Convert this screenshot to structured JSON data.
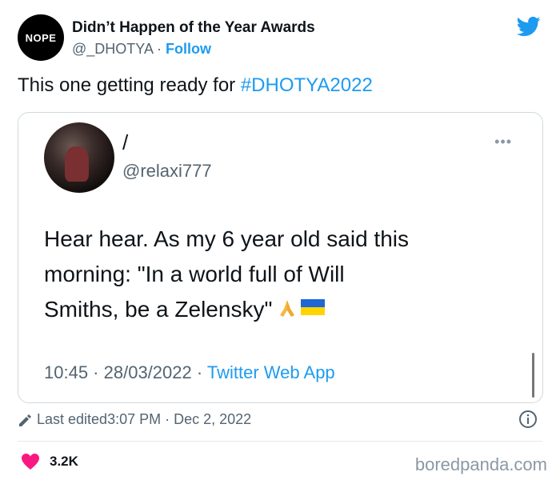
{
  "header": {
    "avatar_text": "NOPE",
    "author_name": "Didn’t Happen of the Year Awards",
    "handle": "@_DHOTYA",
    "separator": " · ",
    "follow_label": "Follow",
    "logo_icon": "twitter-bird-icon",
    "brand_color": "#1d9bf0"
  },
  "tweet": {
    "text": "This one getting ready for ",
    "hashtag": "#DHOTYA2022"
  },
  "quoted": {
    "name": "/",
    "handle": "@relaxi777",
    "more": "•••",
    "line1": "Hear hear. As my 6 year old said this",
    "line2": "morning: \"In a world full of Will",
    "line3": "Smiths, be a Zelensky\"",
    "emoji": "folded-hands-icon",
    "flag": "ukraine-flag-icon",
    "time": "10:45",
    "date": "28/03/2022",
    "dot": " · ",
    "app": "Twitter Web App"
  },
  "footer": {
    "edited_label": "Last edited",
    "edited_time": "3:07 PM",
    "edited_date": "Dec 2, 2022",
    "likes": "3.2K",
    "watermark": "boredpanda.com",
    "like_color": "#f91880"
  }
}
